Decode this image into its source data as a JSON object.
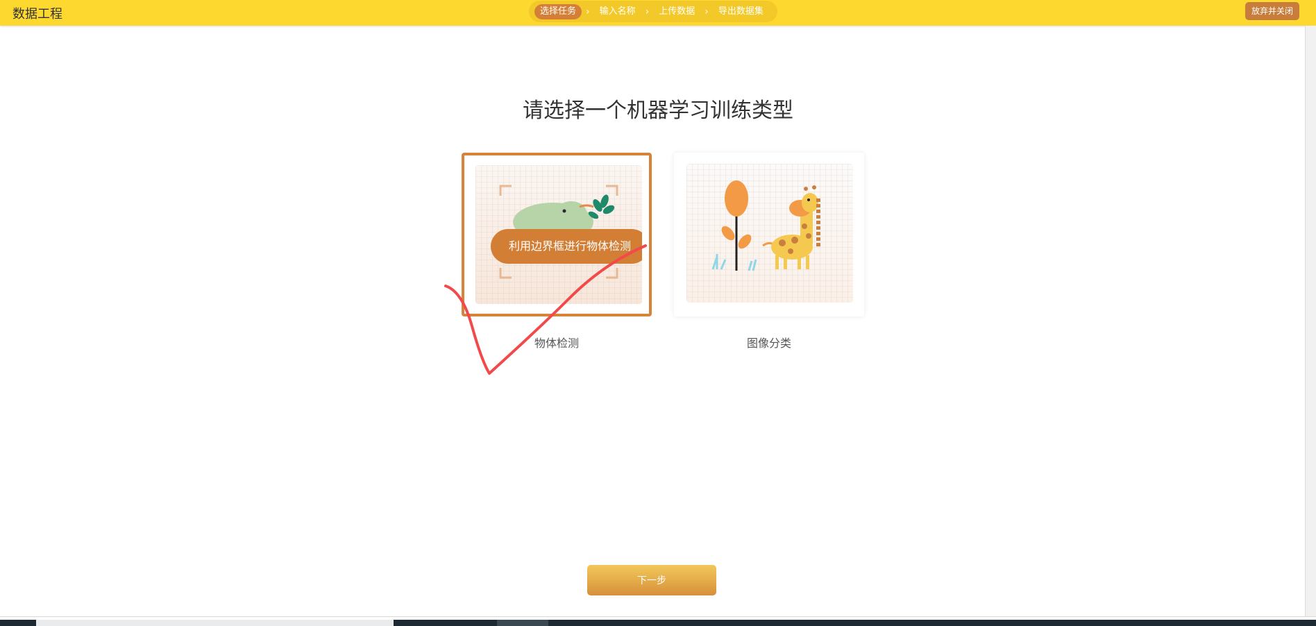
{
  "header": {
    "app_title": "数据工程",
    "steps": [
      {
        "label": "选择任务",
        "active": true
      },
      {
        "label": "输入名称",
        "active": false
      },
      {
        "label": "上传数据",
        "active": false
      },
      {
        "label": "导出数据集",
        "active": false
      }
    ],
    "step_separator": "›",
    "close_label": "放弃并关闭"
  },
  "main": {
    "heading": "请选择一个机器学习训练类型",
    "options": [
      {
        "label": "物体检测",
        "overlay_text": "利用边界框进行物体检测",
        "selected": true
      },
      {
        "label": "图像分类",
        "selected": false
      }
    ],
    "next_label": "下一步"
  },
  "annotation": {
    "type": "hand-drawn-checkmark",
    "color": "#f24a4a"
  },
  "colors": {
    "topbar": "#fdd82e",
    "accent": "#d6843a",
    "button_gradient_top": "#f2c85a",
    "button_gradient_bottom": "#d7903b"
  },
  "icons": {
    "card1_illustration": "dinosaur-icon",
    "card2_illustration": "giraffe-tree-icon"
  }
}
